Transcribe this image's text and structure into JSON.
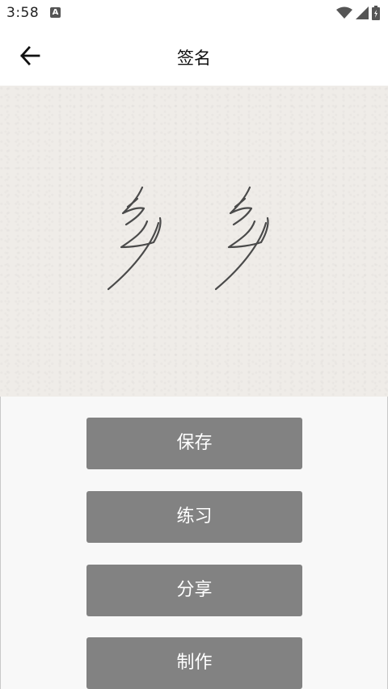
{
  "status_bar": {
    "time": "3:58",
    "notification_badge": "A",
    "icons": [
      "wifi-icon",
      "signal-icon",
      "battery-icon"
    ]
  },
  "header": {
    "title": "签名",
    "back_icon": "arrow-left-icon"
  },
  "signature": {
    "background_color": "#efece8",
    "ink_color": "#4a4a4a",
    "marks": 2
  },
  "actions": {
    "save_label": "保存",
    "practice_label": "练习",
    "share_label": "分享",
    "make_label": "制作",
    "button_color": "#828282"
  }
}
